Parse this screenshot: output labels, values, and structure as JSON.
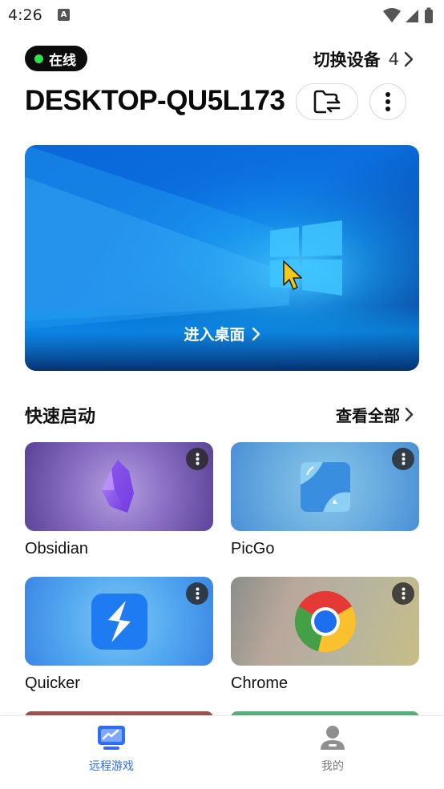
{
  "status_bar": {
    "time": "4:26",
    "notification_glyph": "A"
  },
  "header": {
    "status_badge": "在线",
    "switch_device_label": "切换设备",
    "device_count": "4",
    "device_name": "DESKTOP-QU5L173"
  },
  "desktop_card": {
    "enter_label": "进入桌面"
  },
  "quick_launch": {
    "title": "快速启动",
    "view_all_label": "查看全部",
    "apps": [
      {
        "name": "Obsidian",
        "icon": "obsidian-icon"
      },
      {
        "name": "PicGo",
        "icon": "picgo-icon"
      },
      {
        "name": "Quicker",
        "icon": "quicker-icon"
      },
      {
        "name": "Chrome",
        "icon": "chrome-icon"
      }
    ]
  },
  "bottom_nav": {
    "items": [
      {
        "label": "远程游戏",
        "icon": "remote-game-icon",
        "active": true
      },
      {
        "label": "我的",
        "icon": "profile-icon",
        "active": false
      }
    ]
  },
  "colors": {
    "accent": "#2f6df5",
    "online": "#2ee24a",
    "inactive": "#7a7a7a"
  }
}
